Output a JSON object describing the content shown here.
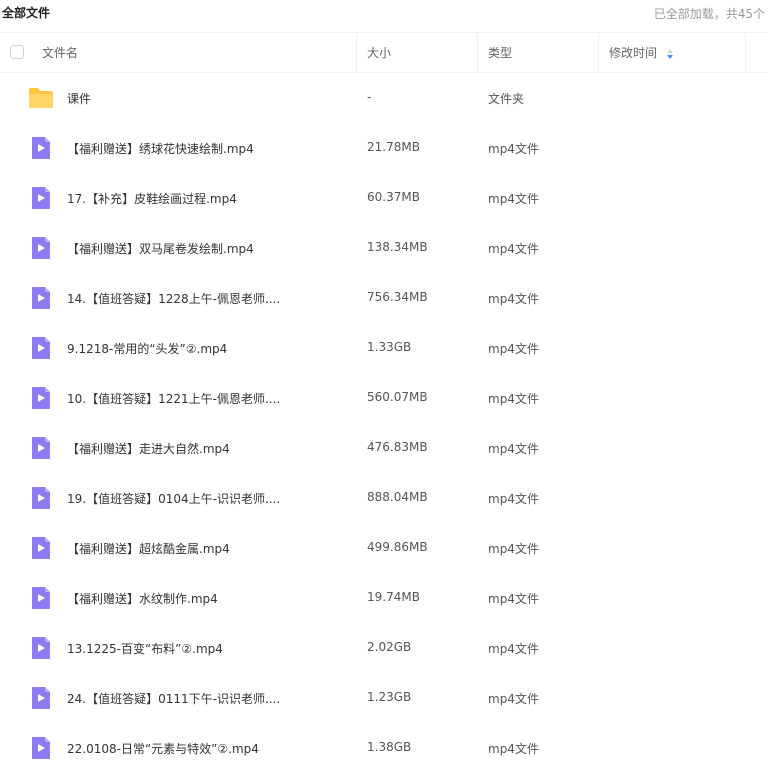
{
  "breadcrumb": "全部文件",
  "load_status": "已全部加载，共45个",
  "columns": {
    "name": "文件名",
    "size": "大小",
    "type": "类型",
    "modified": "修改时间"
  },
  "files": [
    {
      "name": "课件",
      "size": "-",
      "type": "文件夹",
      "icon": "folder-icon"
    },
    {
      "name": "【福利赠送】绣球花快速绘制.mp4",
      "size": "21.78MB",
      "type": "mp4文件",
      "icon": "video-file-icon"
    },
    {
      "name": "17.【补充】皮鞋绘画过程.mp4",
      "size": "60.37MB",
      "type": "mp4文件",
      "icon": "video-file-icon"
    },
    {
      "name": "【福利赠送】双马尾卷发绘制.mp4",
      "size": "138.34MB",
      "type": "mp4文件",
      "icon": "video-file-icon"
    },
    {
      "name": "14.【值班答疑】1228上午-佩恩老师....",
      "size": "756.34MB",
      "type": "mp4文件",
      "icon": "video-file-icon"
    },
    {
      "name": "9.1218-常用的“头发”②.mp4",
      "size": "1.33GB",
      "type": "mp4文件",
      "icon": "video-file-icon"
    },
    {
      "name": "10.【值班答疑】1221上午-佩恩老师....",
      "size": "560.07MB",
      "type": "mp4文件",
      "icon": "video-file-icon"
    },
    {
      "name": "【福利赠送】走进大自然.mp4",
      "size": "476.83MB",
      "type": "mp4文件",
      "icon": "video-file-icon"
    },
    {
      "name": "19.【值班答疑】0104上午-识识老师....",
      "size": "888.04MB",
      "type": "mp4文件",
      "icon": "video-file-icon"
    },
    {
      "name": "【福利赠送】超炫酷金属.mp4",
      "size": "499.86MB",
      "type": "mp4文件",
      "icon": "video-file-icon"
    },
    {
      "name": "【福利赠送】水纹制作.mp4",
      "size": "19.74MB",
      "type": "mp4文件",
      "icon": "video-file-icon"
    },
    {
      "name": "13.1225-百变“布料”②.mp4",
      "size": "2.02GB",
      "type": "mp4文件",
      "icon": "video-file-icon"
    },
    {
      "name": "24.【值班答疑】0111下午-识识老师....",
      "size": "1.23GB",
      "type": "mp4文件",
      "icon": "video-file-icon"
    },
    {
      "name": "22.0108-日常“元素与特效”②.mp4",
      "size": "1.38GB",
      "type": "mp4文件",
      "icon": "video-file-icon"
    }
  ],
  "colors": {
    "video_icon": "#8c7bf2",
    "folder_icon": "#ffc53d",
    "sort_icon": "#3a8ef6",
    "divider": "#eef0f4"
  }
}
